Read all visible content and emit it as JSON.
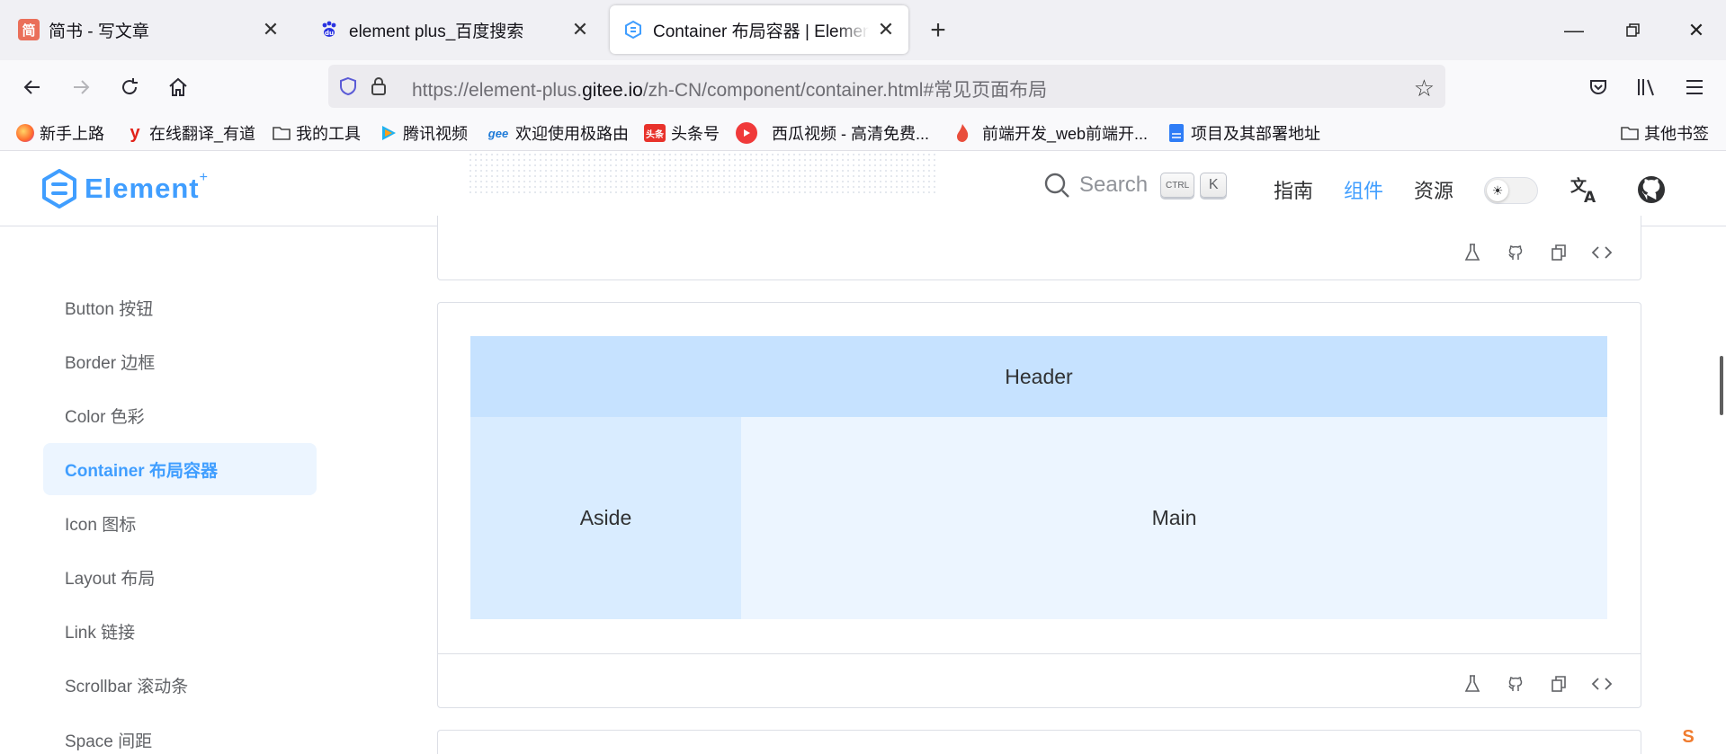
{
  "browser": {
    "tabs": [
      {
        "title": "简书 - 写文章",
        "favicon": "jianshu-icon",
        "favicon_text": "简",
        "active": false
      },
      {
        "title": "element plus_百度搜索",
        "favicon": "baidu-paw-icon",
        "active": false
      },
      {
        "title": "Container 布局容器 | Element",
        "favicon": "element-logo-icon",
        "active": true
      }
    ],
    "url_prefix": "https://element-plus.",
    "url_host": "gitee.io",
    "url_path": "/zh-CN/component/container.html#常见页面布局",
    "bookmarks": [
      {
        "label": "新手上路",
        "icon": "firefox-icon"
      },
      {
        "label": "在线翻译_有道",
        "icon": "youdao-icon"
      },
      {
        "label": "我的工具",
        "icon": "folder-icon"
      },
      {
        "label": "腾讯视频",
        "icon": "tencent-video-icon"
      },
      {
        "label": "欢迎使用极路由",
        "icon": "hiwifi-icon",
        "icon_text": "gee"
      },
      {
        "label": "头条号",
        "icon": "toutiao-icon",
        "icon_text": "头条"
      },
      {
        "label": "西瓜视频 - 高清免费...",
        "icon": "xigua-icon"
      },
      {
        "label": "前端开发_web前端开...",
        "icon": "flame-icon"
      },
      {
        "label": "项目及其部署地址",
        "icon": "doc-icon"
      },
      {
        "label": "其他书签",
        "icon": "folder-icon"
      }
    ]
  },
  "site": {
    "logo_text": "Element",
    "logo_plus": "+",
    "search_placeholder": "Search",
    "kbd_ctrl": "CTRL",
    "kbd_k": "K",
    "nav": [
      {
        "label": "指南",
        "active": false
      },
      {
        "label": "组件",
        "active": true
      },
      {
        "label": "资源",
        "active": false
      }
    ]
  },
  "sidebar": {
    "items": [
      {
        "label": "Button 按钮",
        "active": false
      },
      {
        "label": "Border 边框",
        "active": false
      },
      {
        "label": "Color 色彩",
        "active": false
      },
      {
        "label": "Container 布局容器",
        "active": true
      },
      {
        "label": "Icon 图标",
        "active": false
      },
      {
        "label": "Layout 布局",
        "active": false
      },
      {
        "label": "Link 链接",
        "active": false
      },
      {
        "label": "Scrollbar 滚动条",
        "active": false
      },
      {
        "label": "Space 间距",
        "active": false
      }
    ]
  },
  "demo": {
    "header": "Header",
    "aside": "Aside",
    "main": "Main"
  },
  "colors": {
    "accent": "#409eff",
    "header_bg": "#c6e2ff",
    "aside_bg": "#d9ecff",
    "main_bg": "#ecf5ff"
  }
}
